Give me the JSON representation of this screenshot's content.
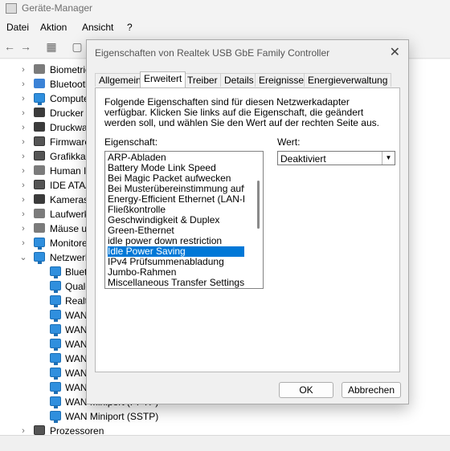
{
  "window": {
    "title": "Geräte-Manager"
  },
  "menu": [
    "Datei",
    "Aktion",
    "Ansicht",
    "?"
  ],
  "tree": {
    "categories": [
      {
        "label": "Biometric"
      },
      {
        "label": "Bluetooth"
      },
      {
        "label": "Computer"
      },
      {
        "label": "Drucker"
      },
      {
        "label": "Druckwa"
      },
      {
        "label": "Firmware"
      },
      {
        "label": "Grafikka"
      },
      {
        "label": "Human I"
      },
      {
        "label": "IDE ATA/A"
      },
      {
        "label": "Kameras"
      },
      {
        "label": "Laufwerk"
      },
      {
        "label": "Mäuse u"
      },
      {
        "label": "Monitore"
      },
      {
        "label": "Netzwerk"
      }
    ],
    "net_children": [
      {
        "label": "Bluet"
      },
      {
        "label": "Qualc"
      },
      {
        "label": "Realte"
      },
      {
        "label": "WAN"
      },
      {
        "label": "WAN"
      },
      {
        "label": "WAN"
      },
      {
        "label": "WAN"
      },
      {
        "label": "WAN"
      },
      {
        "label": "WAN"
      },
      {
        "label": "WAN Miniport (PPTP)"
      },
      {
        "label": "WAN Miniport (SSTP)"
      }
    ],
    "last": {
      "label": "Prozessoren"
    }
  },
  "dialog": {
    "title": "Eigenschaften von Realtek USB GbE Family Controller",
    "tabs": [
      "Allgemein",
      "Erweitert",
      "Treiber",
      "Details",
      "Ereignisse",
      "Energieverwaltung"
    ],
    "active_tab": "Erweitert",
    "description": "Folgende Eigenschaften sind für diesen Netzwerkadapter verfügbar. Klicken Sie links auf die Eigenschaft, die geändert werden soll, und wählen Sie den Wert auf der rechten Seite aus.",
    "property_label": "Eigenschaft:",
    "value_label": "Wert:",
    "properties": [
      "ARP-Abladen",
      "Battery Mode Link Speed",
      "Bei Magic Packet aufwecken",
      "Bei Musterübereinstimmung aufwecken",
      "Energy-Efficient Ethernet (LAN-Energie)",
      "Fließkontrolle",
      "Geschwindigkeit & Duplex",
      "Green-Ethernet",
      "idle power down restriction",
      "Idle Power Saving",
      "IPv4 Prüfsummenabladung",
      "Jumbo-Rahmen",
      "Miscellaneous Transfer Settings"
    ],
    "selected_property": "Idle Power Saving",
    "value": "Deaktiviert",
    "ok_label": "OK",
    "cancel_label": "Abbrechen",
    "accent_color": "#0078d7"
  }
}
